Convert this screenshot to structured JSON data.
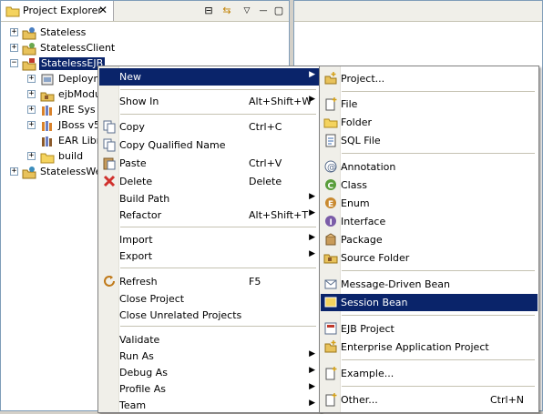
{
  "explorer": {
    "tab_title": "Project Explorer",
    "close": "✕",
    "collapse_all": "⊟",
    "link_editor": "⇆",
    "view_menu": "▽",
    "minimize": "—",
    "maximize": "▢"
  },
  "tree": {
    "items": [
      {
        "label": "Stateless",
        "expander": "+"
      },
      {
        "label": "StatelessClient",
        "expander": "+"
      },
      {
        "label": "StatelessEJB",
        "expander": "−"
      },
      {
        "label": "Deploym",
        "expander": "+"
      },
      {
        "label": "ejbModu",
        "expander": "+"
      },
      {
        "label": "JRE Sys",
        "expander": "+"
      },
      {
        "label": "JBoss v5",
        "expander": "+"
      },
      {
        "label": "EAR Libr",
        "expander": ""
      },
      {
        "label": "build",
        "expander": "+"
      },
      {
        "label": "StatelessWe",
        "expander": "+"
      }
    ]
  },
  "context_menu": {
    "items": [
      {
        "label": "New",
        "shortcut": ""
      },
      {
        "label": "Show In",
        "shortcut": "Alt+Shift+W"
      },
      {
        "label": "Copy",
        "shortcut": "Ctrl+C"
      },
      {
        "label": "Copy Qualified Name",
        "shortcut": ""
      },
      {
        "label": "Paste",
        "shortcut": "Ctrl+V"
      },
      {
        "label": "Delete",
        "shortcut": "Delete"
      },
      {
        "label": "Build Path",
        "shortcut": ""
      },
      {
        "label": "Refactor",
        "shortcut": "Alt+Shift+T"
      },
      {
        "label": "Import",
        "shortcut": ""
      },
      {
        "label": "Export",
        "shortcut": ""
      },
      {
        "label": "Refresh",
        "shortcut": "F5"
      },
      {
        "label": "Close Project",
        "shortcut": ""
      },
      {
        "label": "Close Unrelated Projects",
        "shortcut": ""
      },
      {
        "label": "Validate",
        "shortcut": ""
      },
      {
        "label": "Run As",
        "shortcut": ""
      },
      {
        "label": "Debug As",
        "shortcut": ""
      },
      {
        "label": "Profile As",
        "shortcut": ""
      },
      {
        "label": "Team",
        "shortcut": ""
      }
    ]
  },
  "new_submenu": {
    "items": [
      {
        "label": "Project...",
        "shortcut": ""
      },
      {
        "label": "File",
        "shortcut": ""
      },
      {
        "label": "Folder",
        "shortcut": ""
      },
      {
        "label": "SQL File",
        "shortcut": ""
      },
      {
        "label": "Annotation",
        "shortcut": ""
      },
      {
        "label": "Class",
        "shortcut": ""
      },
      {
        "label": "Enum",
        "shortcut": ""
      },
      {
        "label": "Interface",
        "shortcut": ""
      },
      {
        "label": "Package",
        "shortcut": ""
      },
      {
        "label": "Source Folder",
        "shortcut": ""
      },
      {
        "label": "Message-Driven Bean",
        "shortcut": ""
      },
      {
        "label": "Session Bean",
        "shortcut": ""
      },
      {
        "label": "EJB Project",
        "shortcut": ""
      },
      {
        "label": "Enterprise Application Project",
        "shortcut": ""
      },
      {
        "label": "Example...",
        "shortcut": ""
      },
      {
        "label": "Other...",
        "shortcut": "Ctrl+N"
      }
    ]
  },
  "colors": {
    "selection": "#0a246a",
    "menu_bg": "#ffffff",
    "chrome": "#d4d0c8"
  }
}
